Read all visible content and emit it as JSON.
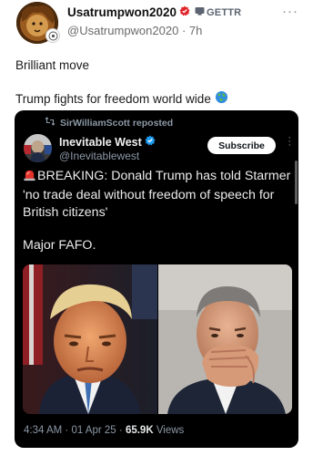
{
  "post": {
    "username": "Usatrumpwon2020",
    "platform_badge": "GETTR",
    "handle": "@Usatrumpwon2020",
    "separator": "·",
    "time": "7h",
    "more_icon": "more-dots-icon",
    "text_line_1": "Brilliant move",
    "text_line_2": "Trump fights for freedom world wide"
  },
  "embedded": {
    "repost_text": "SirWilliamScott reposted",
    "account_name": "Inevitable West",
    "account_handle": "@Inevitablewest",
    "subscribe_label": "Subscribe",
    "body_line": "BREAKING: Donald Trump has told Starmer 'no trade deal without freedom of speech for British citizens'",
    "body_line_2": "Major FAFO.",
    "time": "4:34 AM",
    "dot": "·",
    "date": "01 Apr 25",
    "views_count": "65.9K",
    "views_label": "Views"
  },
  "colors": {
    "gettr_red": "#e0242a",
    "verified_blue": "#1d9bf0",
    "card_bg": "#000000",
    "muted_text": "#8b98a5"
  }
}
